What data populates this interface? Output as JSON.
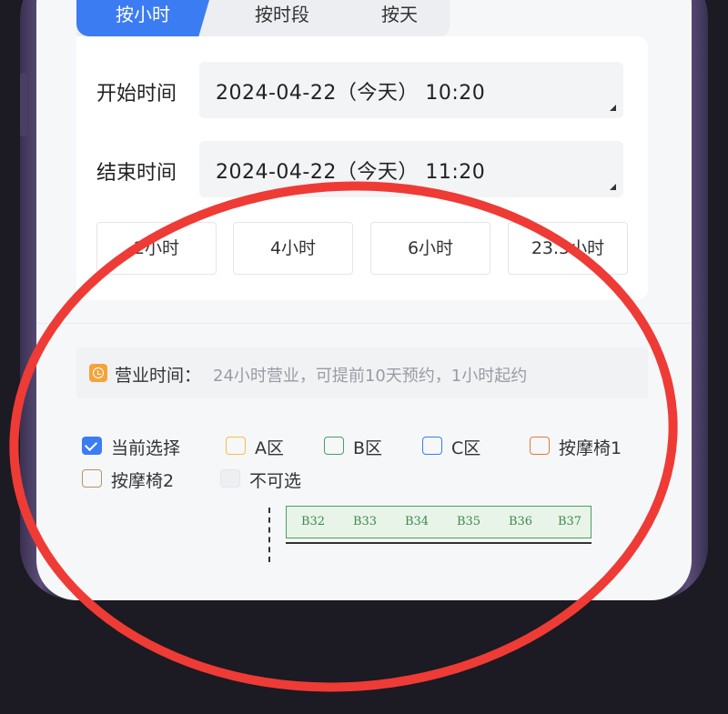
{
  "tabs": [
    {
      "label": "按小时",
      "active": true
    },
    {
      "label": "按时段",
      "active": false
    },
    {
      "label": "按天",
      "active": false
    }
  ],
  "form": {
    "start_label": "开始时间",
    "start_value": "2024-04-22（今天） 10:20",
    "end_label": "结束时间",
    "end_value": "2024-04-22（今天） 11:20"
  },
  "durations": [
    "2小时",
    "4小时",
    "6小时",
    "23.5小时"
  ],
  "notice": {
    "label": "营业时间：",
    "text": "24小时营业，可提前10天预约，1小时起约"
  },
  "legend": [
    {
      "label": "当前选择",
      "color": "#3c7cf3",
      "checked": true
    },
    {
      "label": "A区",
      "color": "#f1c04a"
    },
    {
      "label": "B区",
      "color": "#4aa05c"
    },
    {
      "label": "C区",
      "color": "#3c7cf3"
    },
    {
      "label": "按摩椅1",
      "color": "#e07a3a"
    },
    {
      "label": "按摩椅2",
      "color": "#b59565"
    },
    {
      "label": "不可选",
      "color": "#e3e5e9"
    }
  ],
  "seats": [
    "B32",
    "B33",
    "B34",
    "B35",
    "B36",
    "B37"
  ],
  "annotation_color": "#ee3b35"
}
